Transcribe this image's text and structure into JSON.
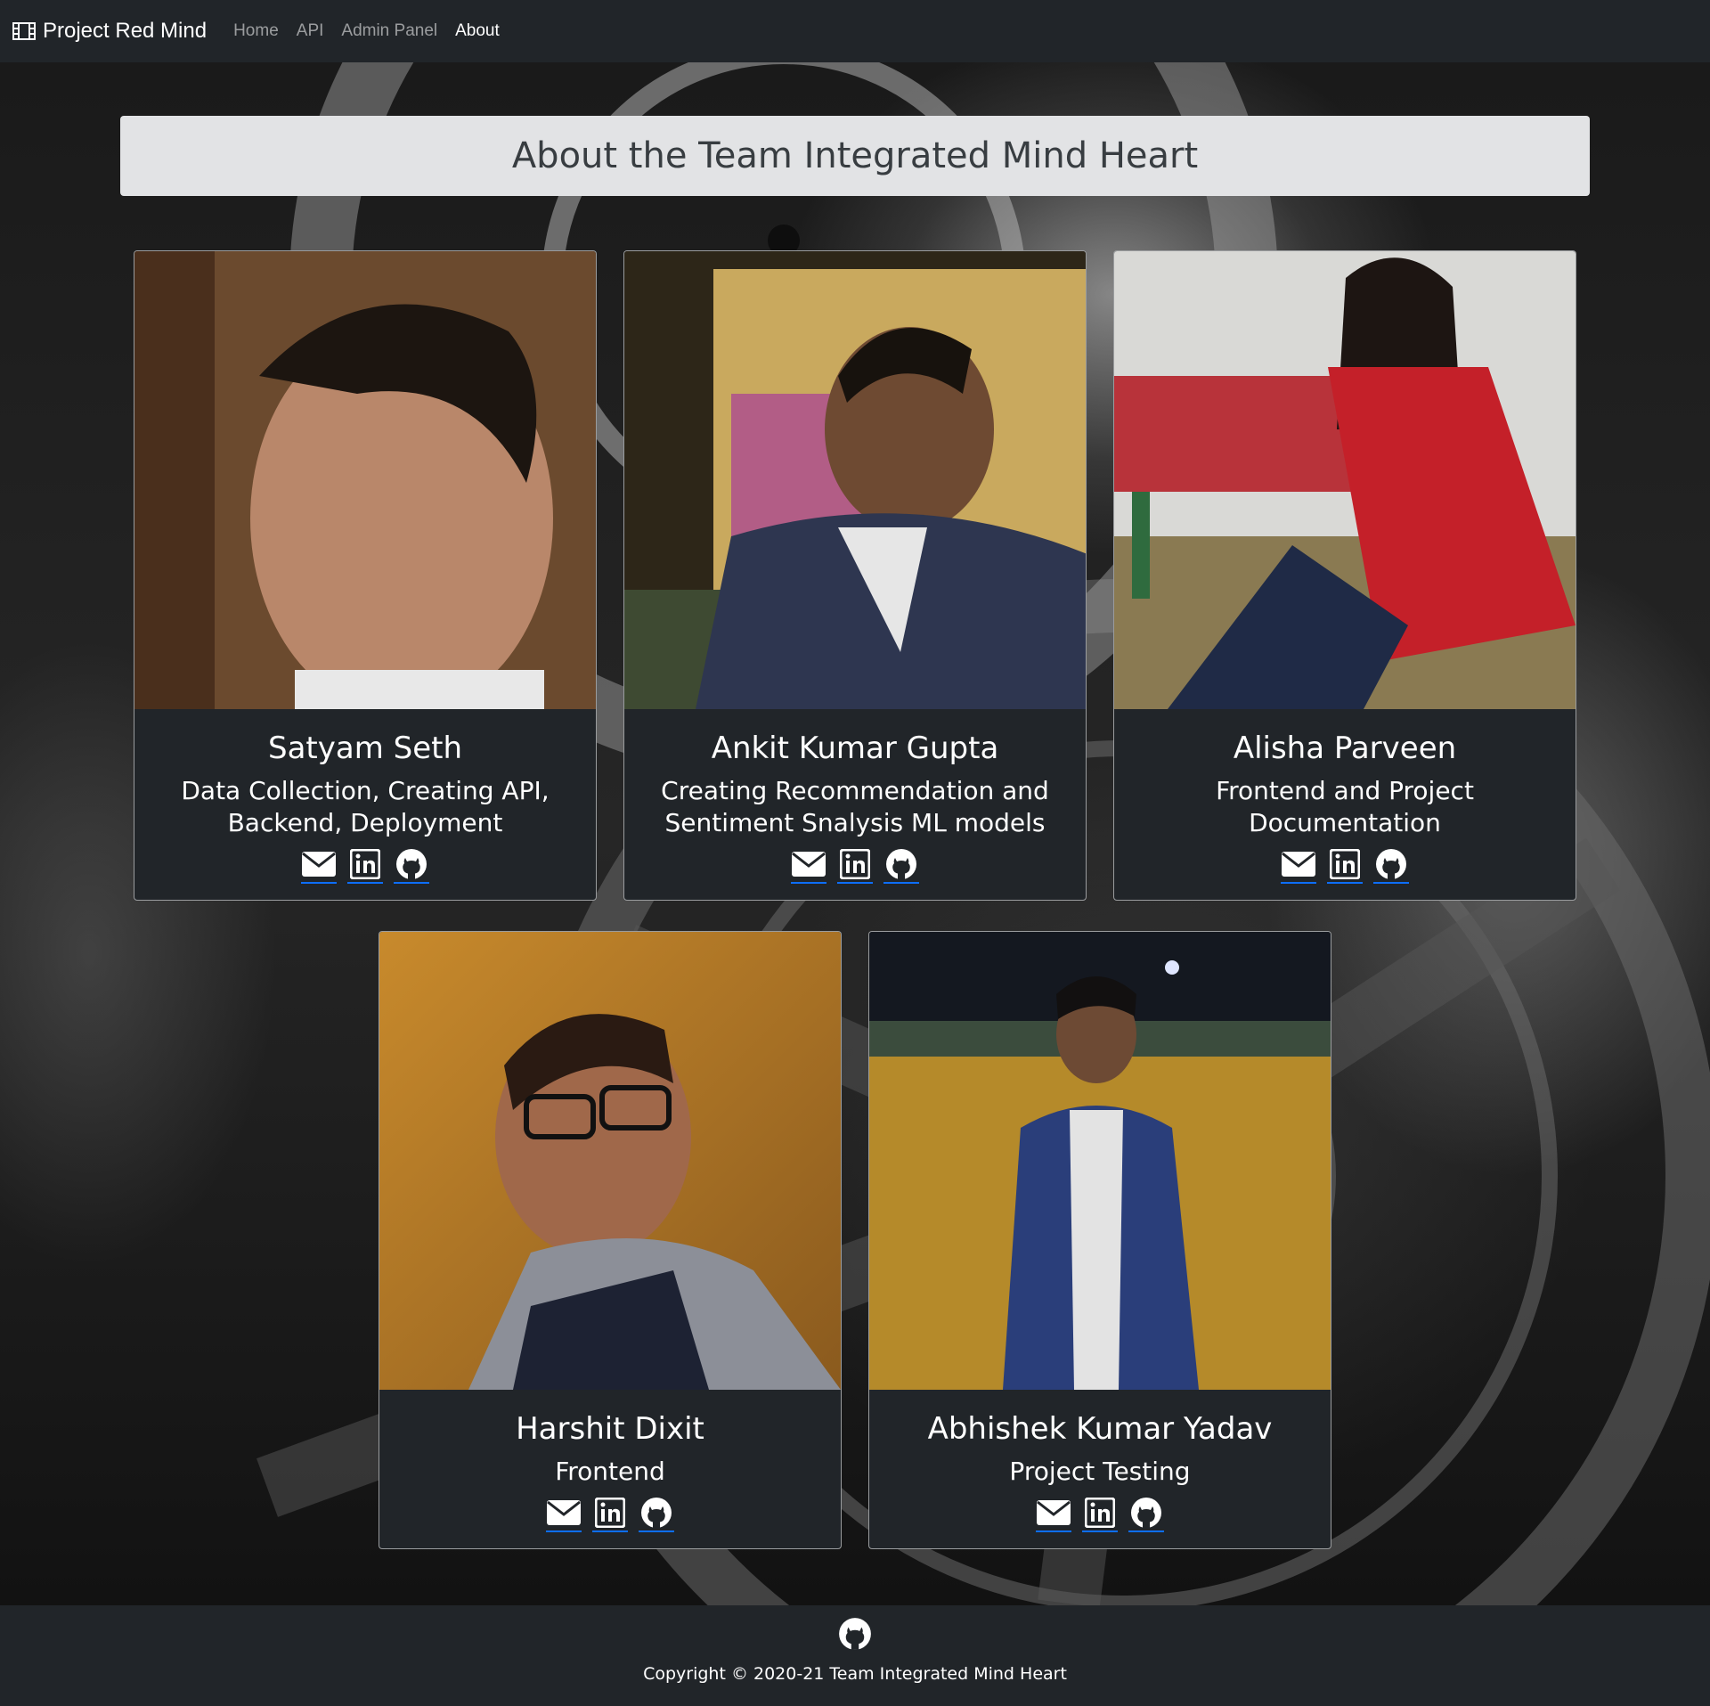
{
  "navbar": {
    "brand": "Project Red Mind",
    "links": [
      {
        "label": "Home",
        "active": false
      },
      {
        "label": "API",
        "active": false
      },
      {
        "label": "Admin Panel",
        "active": false
      },
      {
        "label": "About",
        "active": true
      }
    ]
  },
  "banner": {
    "title": "About the Team Integrated Mind Heart"
  },
  "team": [
    {
      "name": "Satyam Seth",
      "role_line1": "Data Collection, Creating API,",
      "role_line2": "Backend, Deployment"
    },
    {
      "name": "Ankit Kumar Gupta",
      "role_line1": "Creating Recommendation and",
      "role_line2": "Sentiment Snalysis ML models"
    },
    {
      "name": "Alisha Parveen",
      "role_line1": "Frontend and Project",
      "role_line2": "Documentation"
    },
    {
      "name": "Harshit Dixit",
      "role_line1": "Frontend",
      "role_line2": ""
    },
    {
      "name": "Abhishek Kumar Yadav",
      "role_line1": "Project Testing",
      "role_line2": ""
    }
  ],
  "icons": [
    "envelope-icon",
    "linkedin-icon",
    "github-icon"
  ],
  "footer": {
    "copyright": "Copyright © 2020-21 Team Integrated Mind Heart"
  },
  "colors": {
    "navbar": "#212529",
    "banner": "#e2e3e5",
    "banner_text": "#383d41",
    "link_underline": "#0d6efd"
  }
}
